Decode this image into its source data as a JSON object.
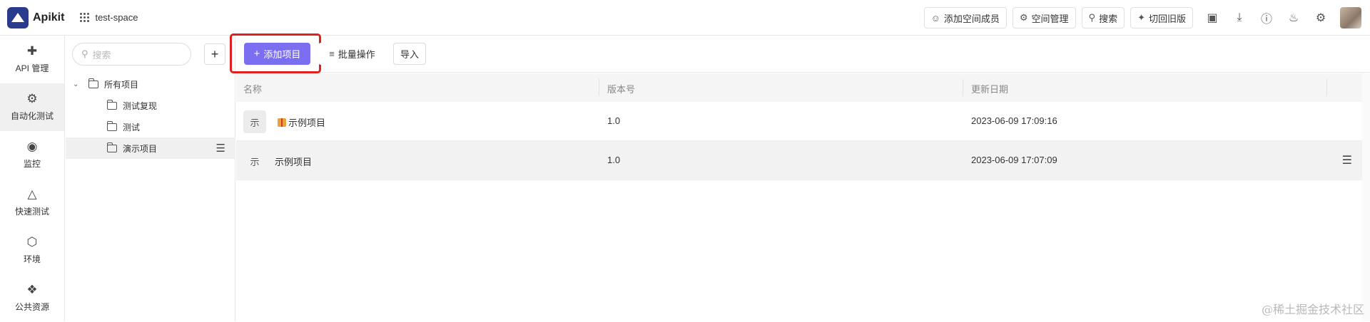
{
  "app": {
    "name": "Apikit",
    "space": "test-space"
  },
  "header": {
    "buttons": [
      {
        "icon": "add-user-icon",
        "label": "添加空间成员"
      },
      {
        "icon": "gear-icon",
        "label": "空间管理"
      },
      {
        "icon": "search-icon",
        "label": "搜索"
      },
      {
        "icon": "wand-icon",
        "label": "切回旧版"
      }
    ]
  },
  "nav": {
    "items": [
      {
        "icon": "api-icon",
        "label": "API 管理"
      },
      {
        "icon": "robot-icon",
        "label": "自动化测试"
      },
      {
        "icon": "monitor-icon",
        "label": "监控"
      },
      {
        "icon": "rocket-icon",
        "label": "快速测试"
      },
      {
        "icon": "cube-icon",
        "label": "环境"
      },
      {
        "icon": "puzzle-icon",
        "label": "公共资源"
      }
    ]
  },
  "tree": {
    "search_placeholder": "搜索",
    "root": "所有项目",
    "children": [
      "测试复现",
      "测试",
      "演示项目"
    ]
  },
  "toolbar": {
    "add_project": "添加项目",
    "batch": "批量操作",
    "import": "导入"
  },
  "table": {
    "columns": [
      "名称",
      "版本号",
      "更新日期"
    ],
    "rows": [
      {
        "badge": "示",
        "name": "示例项目",
        "version": "1.0",
        "updated": "2023-06-09 17:09:16"
      },
      {
        "badge": "示",
        "name": "示例项目",
        "version": "1.0",
        "updated": "2023-06-09 17:07:09"
      }
    ]
  },
  "watermark": "@稀土掘金技术社区"
}
